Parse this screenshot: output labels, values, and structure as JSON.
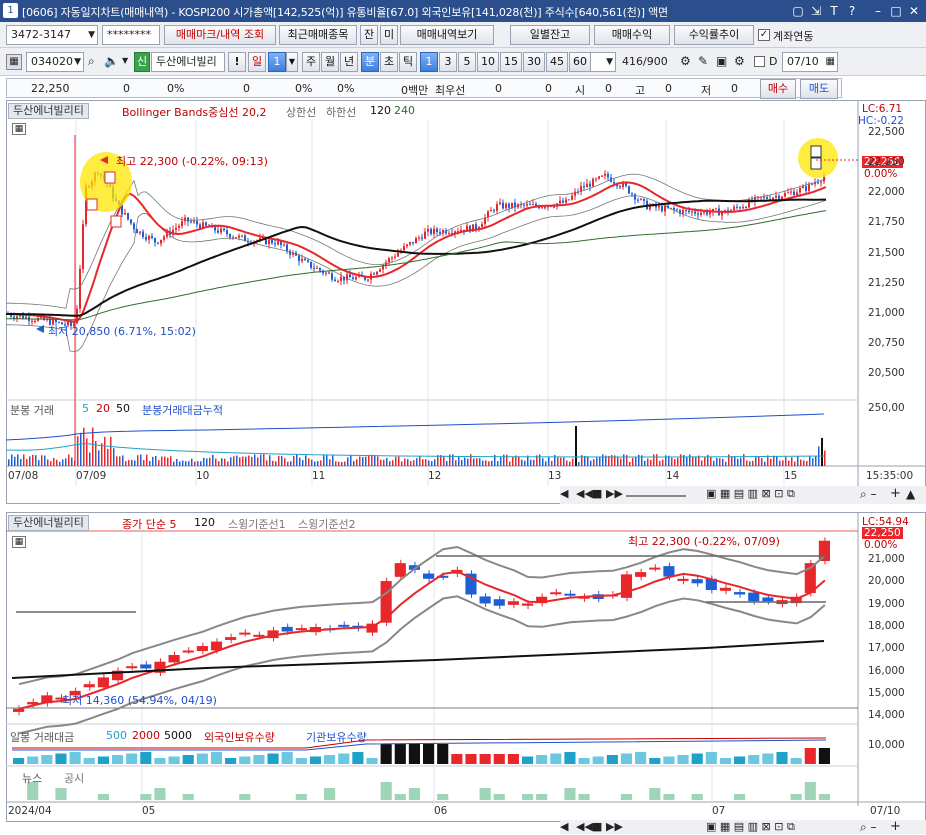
{
  "titlebar": {
    "window_num": "1",
    "title": "[0606] 자동일지차트(매매내역) - KOSPI200 시가총액[142,525(억)] 유통비율[67.0] 외국인보유[141,028(천)] 주식수[640,561(천)] 액면"
  },
  "toolbar1": {
    "account": "3472-3147",
    "password": "********",
    "btn_trade_mark": "매매마크/내역 조회",
    "btn_recent": "최근매매종목",
    "btn_jan": "잔",
    "btn_mi": "미",
    "btn_history": "매매내역보기",
    "btn_daily_bal": "일별잔고",
    "btn_profit": "매매수익",
    "btn_rate": "수익률추이",
    "check_link": "계좌연동"
  },
  "toolbar2": {
    "code": "034020",
    "name_prefix": "신",
    "name": "두산에너빌리",
    "btn_il": "일",
    "period_value": "1",
    "btn_ju": "주",
    "btn_wol": "월",
    "btn_nyeon": "년",
    "btn_bun": "분",
    "btn_cho": "초",
    "btn_tik": "틱",
    "intervals": [
      "1",
      "3",
      "5",
      "10",
      "15",
      "30",
      "45",
      "60"
    ],
    "count_value": "1",
    "count_display": "416/900",
    "d_label": "D",
    "date_value": "07/10"
  },
  "quote_bar": {
    "price": "22,250",
    "v1": "0",
    "p1": "0%",
    "v2": "0",
    "p2": "0%",
    "p3": "0%",
    "unit": "0백만",
    "best_label": "최우선",
    "b1": "0",
    "b2": "0",
    "si": "시",
    "si_v": "0",
    "go": "고",
    "go_v": "0",
    "jeo": "저",
    "jeo_v": "0",
    "buy": "매수",
    "sell": "매도"
  },
  "top_chart": {
    "stock_label": "두산에너빌리티",
    "indicator": "Bollinger Bands중심선 20,2",
    "upper": "상한선",
    "lower": "하한선",
    "ma1": "120",
    "ma2": "240",
    "lc": "LC:6.71",
    "hc": "HC:-0.22",
    "high_ann": "최고 22,300 (-0.22%, 09:13)",
    "low_ann": "최저 20,850 (6.71%, 15:02)",
    "price_tag": "22,250",
    "pct_tag": "0.00%",
    "y_labels": [
      "22,500",
      "22,250",
      "22,000",
      "21,750",
      "21,500",
      "21,250",
      "21,000",
      "20,750",
      "20,500"
    ],
    "vol_label": "분봉 거래",
    "vol_5": "5",
    "vol_20": "20",
    "vol_50": "50",
    "vol_cum": "분봉거래대금누적",
    "vol_axis": "250,00",
    "x_labels": [
      "07/08",
      "07/09",
      "10",
      "11",
      "12",
      "13",
      "14",
      "15"
    ],
    "time_label": "15:35:00"
  },
  "bottom_chart": {
    "stock_label": "두산에너빌리티",
    "indicator": "종가 단순 5",
    "ma120": "120",
    "swing1": "스윙기준선1",
    "swing2": "스윙기준선2",
    "lc": "LC:54.94",
    "high_ann": "최고 22,300 (-0.22%, 07/09)",
    "low_ann": "최저 14,360 (54.94%, 04/19)",
    "price_tag": "22,250",
    "pct_tag": "0.00%",
    "y_labels": [
      "21,000",
      "20,000",
      "19,000",
      "18,000",
      "17,000",
      "16,000",
      "15,000",
      "14,000"
    ],
    "vol_label": "일봉 거래대금",
    "vol_500": "500",
    "vol_2000": "2000",
    "vol_5000": "5000",
    "foreign": "외국인보유수량",
    "inst": "기관보유수량",
    "vol_axis": "10,000",
    "news": "뉴스",
    "gongsi": "공시",
    "x_labels": [
      "2024/04",
      "05",
      "06",
      "07"
    ],
    "date_label": "07/10"
  },
  "colors": {
    "up": "#e8272b",
    "down": "#1f5fd6",
    "accent": "#2b4f8c",
    "highlight": "#ffe600"
  }
}
